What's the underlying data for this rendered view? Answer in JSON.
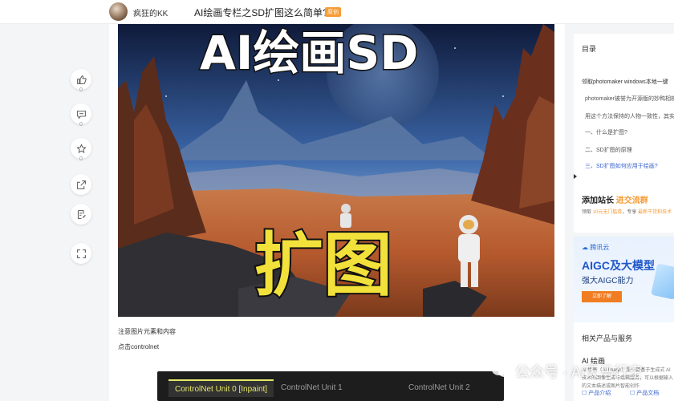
{
  "header": {
    "author": "疯狂的KK",
    "title": "AI绘画专栏之SD扩图这么简单?",
    "badge": "原创"
  },
  "rail": {
    "like_count": "0",
    "comment_count": "0",
    "favorite_count": "0"
  },
  "article": {
    "hero_title": "AI绘画SD",
    "hero_subtitle": "扩图",
    "caption1": "注意图片元素和内容",
    "caption2": "点击controlnet",
    "controlnet_tabs": [
      "ControlNet Unit 0 [Inpaint]",
      "ControlNet Unit 1",
      "ControlNet Unit 2"
    ]
  },
  "toc": {
    "title": "目录",
    "items": [
      "领取photomaker windows本地一键",
      "photomaker被誉为开源版的妙鸭相机",
      "用这个方法保持的人物一致性，其实",
      "一、什么是扩图?",
      "二、SD扩图的原理",
      "三、SD扩图如何应用于绘画?"
    ]
  },
  "recruit": {
    "title": "添加站长",
    "title_hl": "进交流群",
    "sub_prefix": "领取",
    "sub_hl1": "10元无门槛券",
    "sub_mid": "，专享",
    "sub_hl2": "最新干货和技术"
  },
  "ad": {
    "logo": "腾讯云",
    "title": "AIGC及大模型",
    "subtitle": "强大AIGC能力",
    "button": "立即了解"
  },
  "related": {
    "title": "相关产品与服务",
    "name": "AI 绘画",
    "desc": "AI 绘画（AI Image）是一款基于生成式 AI 技术的图像生成与编辑服务，可以根据输入的文本描述或图片智能创作",
    "link1": "产品介绍",
    "link2": "产品文档"
  },
  "watermark": "公众号 · AI天马行空",
  "colors": {
    "accent_orange": "#f79b34",
    "link_blue": "#3a63ce",
    "controlnet_active": "#e6e86a"
  }
}
